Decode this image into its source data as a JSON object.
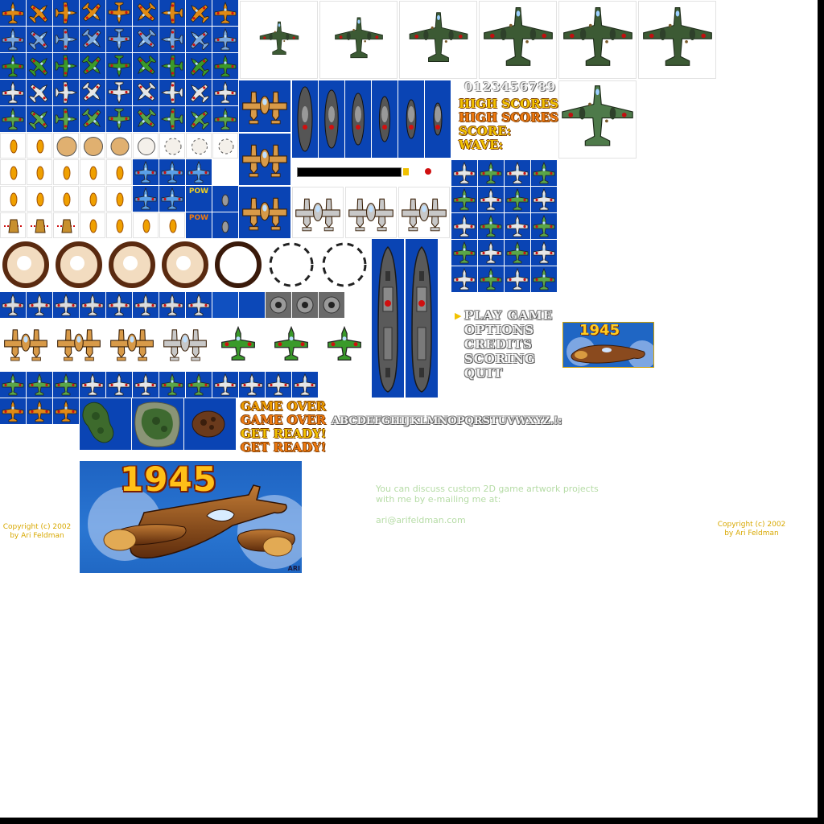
{
  "sheet": {
    "digits": "0123456789",
    "labels": [
      "HIGH SCORES",
      "HIGH SCORES",
      "SCORE:",
      "WAVE:"
    ],
    "end_labels": [
      "GAME OVER",
      "GAME OVER",
      "GET READY!",
      "GET READY!"
    ],
    "menu": {
      "cursor": "▶",
      "items": [
        "PLAY GAME",
        "OPTIONS",
        "CREDITS",
        "SCORING",
        "QUIT"
      ]
    },
    "alphabet": "ABCDEFGHIJKLMNOPQRSTUVWXYZ.!:",
    "pow": "POW",
    "title_small": "1945",
    "title_big": "1945",
    "signature": "ARI",
    "copyright_left": [
      "Copyright (c) 2002",
      "by Ari Feldman"
    ],
    "copyright_right": [
      "Copyright (c) 2002",
      "by Ari Feldman"
    ],
    "contact": [
      "You can discuss custom 2D game artwork projects",
      "with me by e-mailing me at:",
      "",
      "ari@arifeldman.com"
    ]
  },
  "colors": {
    "sea_blue": "#0a44b4",
    "plane_orange": "#e08a14",
    "plane_green": "#3a9a2a",
    "bomber_green": "#3c5a34",
    "text_yellow": "#f2c200",
    "text_orange": "#f07a10"
  }
}
